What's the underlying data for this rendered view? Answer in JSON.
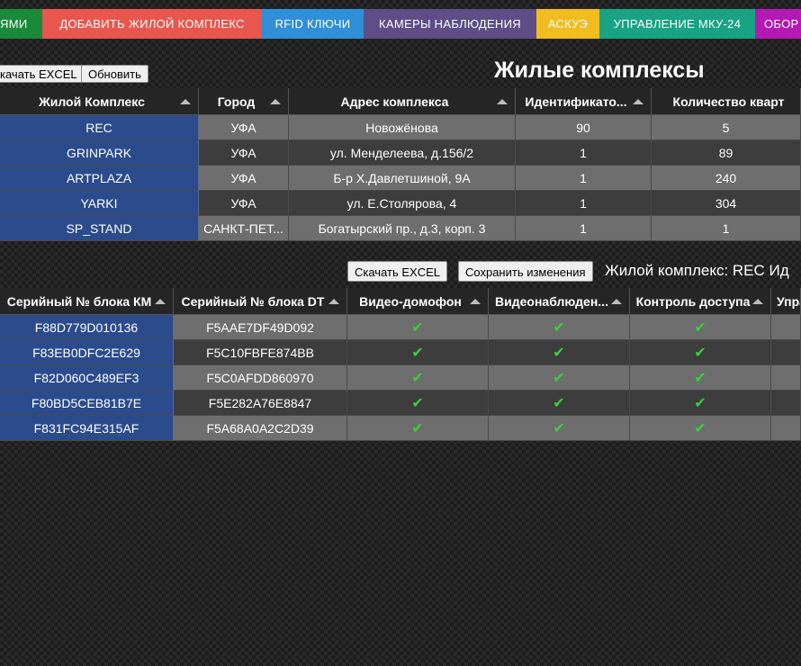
{
  "nav": {
    "tabs": [
      {
        "label": "ЯМИ",
        "color": "#1a8a3a"
      },
      {
        "label": "ДОБАВИТЬ ЖИЛОЙ КОМПЛЕКС",
        "color": "#e8564e"
      },
      {
        "label": "RFID КЛЮЧИ",
        "color": "#2f8fd8"
      },
      {
        "label": "КАМЕРЫ НАБЛЮДЕНИЯ",
        "color": "#5e4d86"
      },
      {
        "label": "АСКУЭ",
        "color": "#f0bc1e"
      },
      {
        "label": "УПРАВЛЕНИЕ МКУ-24",
        "color": "#18a384"
      },
      {
        "label": "ОБОР",
        "color": "#b31ab3"
      }
    ]
  },
  "complexes": {
    "title": "Жилые комплексы",
    "download_label": "качать EXCEL",
    "refresh_label": "Обновить",
    "columns": [
      "Жилой Комплекс",
      "Город",
      "Адрес комплекса",
      "Идентификато...",
      "Количество кварт"
    ],
    "rows": [
      [
        "REC",
        "УФА",
        "Новожёнова",
        "90",
        "5"
      ],
      [
        "GRINPARK",
        "УФА",
        "ул. Менделеева, д.156/2",
        "1",
        "89"
      ],
      [
        "ARTPLAZA",
        "УФА",
        "Б-р Х.Давлетшиной, 9А",
        "1",
        "240"
      ],
      [
        "YARKI",
        "УФА",
        "ул. Е.Столярова, 4",
        "1",
        "304"
      ],
      [
        "SP_STAND",
        "САНКТ-ПЕТ...",
        "Богатырский пр., д.3, корп. 3",
        "1",
        "1"
      ]
    ]
  },
  "blocks": {
    "download_label": "Скачать EXCEL",
    "save_label": "Сохранить изменения",
    "subtitle": "Жилой комплекс: REC Ид",
    "columns": [
      "Серийный № блока КМ",
      "Серийный № блока DT",
      "Видео-домофон",
      "Видеонаблюден...",
      "Контроль доступа",
      "Упра"
    ],
    "check_glyph": "✔",
    "rows": [
      {
        "km": "F88D779D010136",
        "dt": "F5AAE7DF49D092",
        "video_intercom": true,
        "video_surveillance": true,
        "access_control": true
      },
      {
        "km": "F83EB0DFC2E629",
        "dt": "F5C10FBFE874BB",
        "video_intercom": true,
        "video_surveillance": true,
        "access_control": true
      },
      {
        "km": "F82D060C489EF3",
        "dt": "F5C0AFDD860970",
        "video_intercom": true,
        "video_surveillance": true,
        "access_control": true
      },
      {
        "km": "F80BD5CEB81B7E",
        "dt": "F5E282A76E8847",
        "video_intercom": true,
        "video_surveillance": true,
        "access_control": true
      },
      {
        "km": "F831FC94E315AF",
        "dt": "F5A68A0A2C2D39",
        "video_intercom": true,
        "video_surveillance": true,
        "access_control": true
      }
    ]
  }
}
